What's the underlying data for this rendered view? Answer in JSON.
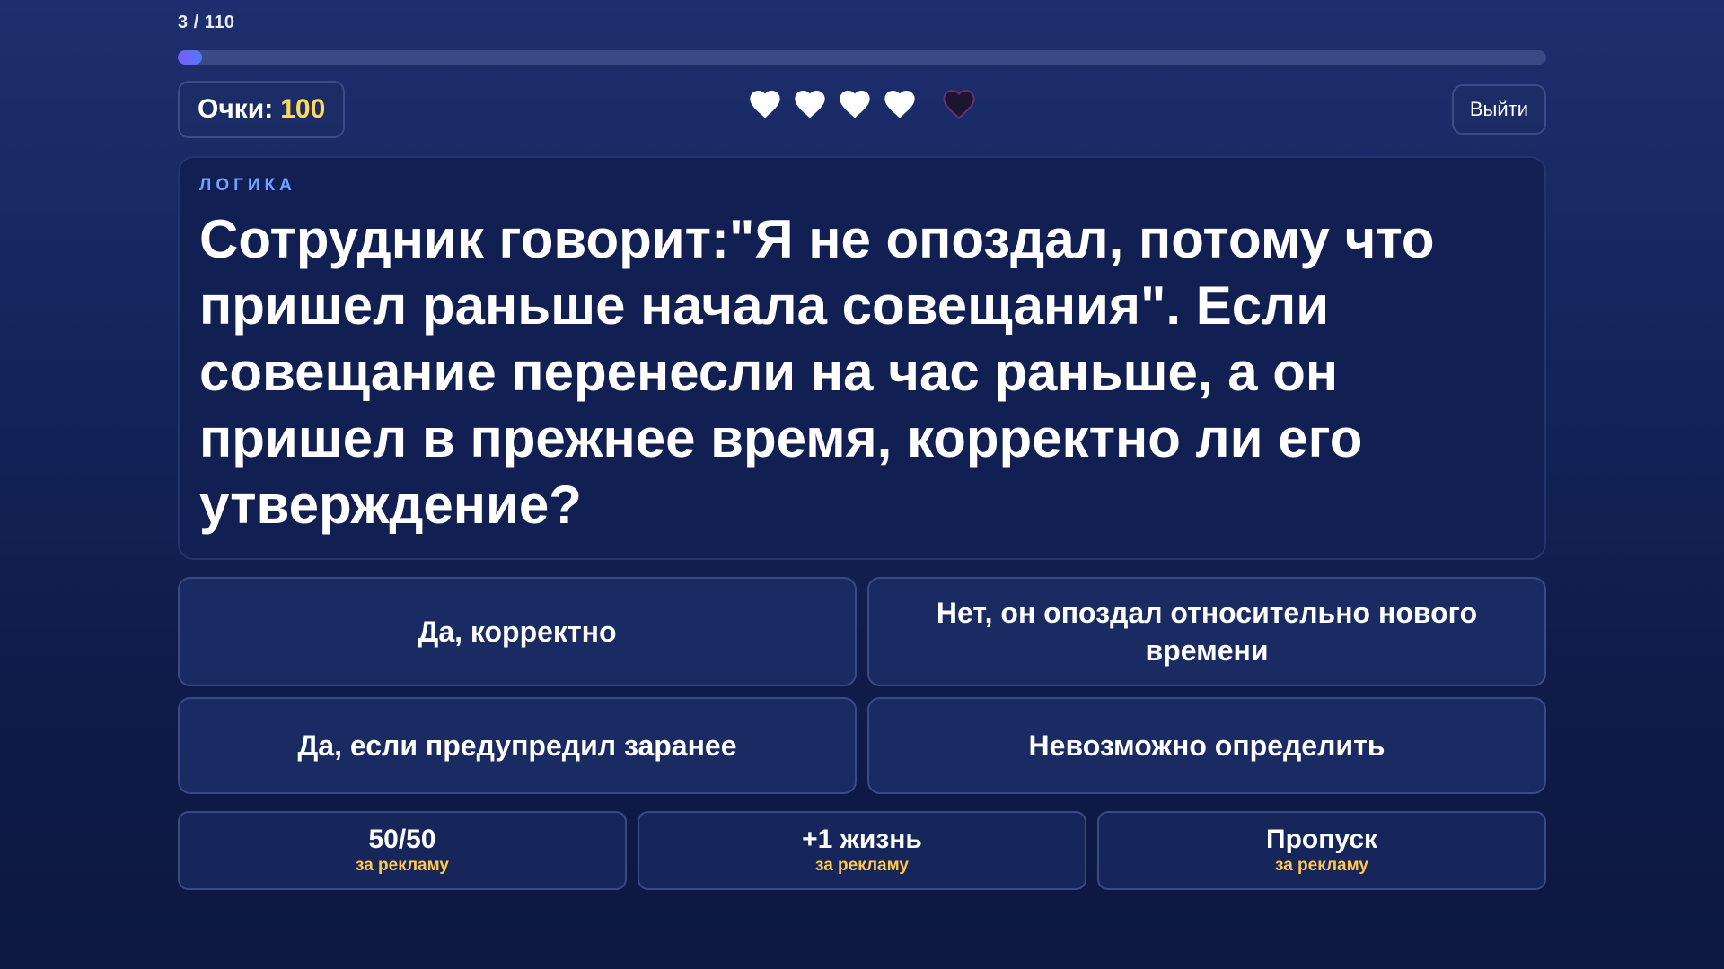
{
  "progress": {
    "text": "3 / 110",
    "fraction": 0.018,
    "color_from": "#7b5cff",
    "color_to": "#4f7bff"
  },
  "score": {
    "label": "Очки:",
    "value": "100",
    "value_color": "#ffd95a"
  },
  "lives": {
    "total": 5,
    "remaining": 4,
    "full_icon": "heart-icon",
    "lost_icon": "heart-empty-icon"
  },
  "exit_button": {
    "label": "Выйти"
  },
  "question": {
    "category": "ЛОГИКА",
    "text": "Сотрудник говорит:\"Я не опоздал, потому что пришел раньше начала совещания\". Если совещание перенесли на час раньше, а он пришел в прежнее время, корректно ли его утверждение?"
  },
  "answers": [
    {
      "label": "Да, корректно"
    },
    {
      "label": "Нет, он опоздал относительно нового времени"
    },
    {
      "label": "Да, если предупредил заранее"
    },
    {
      "label": "Невозможно определить"
    }
  ],
  "bonuses": [
    {
      "title": "50/50",
      "subtitle": "за рекламу"
    },
    {
      "title": "+1 жизнь",
      "subtitle": "за рекламу"
    },
    {
      "title": "Пропуск",
      "subtitle": "за рекламу"
    }
  ],
  "colors": {
    "accent_yellow": "#ffd95a",
    "category_blue": "#6fa3ff",
    "background": "#15255c"
  }
}
